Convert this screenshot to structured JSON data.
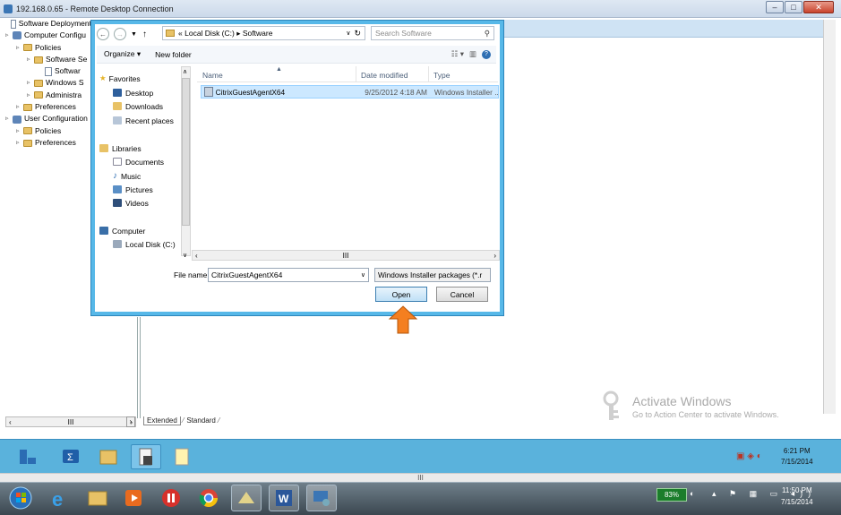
{
  "rdp": {
    "title": "192.168.0.65 - Remote Desktop Connection",
    "min": "–",
    "max": "□",
    "close": "✕"
  },
  "tree": [
    {
      "label": "Software Deployment",
      "indent": 0
    },
    {
      "label": "Computer Configu",
      "indent": 0
    },
    {
      "label": "Policies",
      "indent": 1
    },
    {
      "label": "Software Se",
      "indent": 2
    },
    {
      "label": "Softwar",
      "indent": 3
    },
    {
      "label": "Windows S",
      "indent": 2
    },
    {
      "label": "Administra",
      "indent": 2
    },
    {
      "label": "Preferences",
      "indent": 1
    },
    {
      "label": "User Configuration",
      "indent": 0
    },
    {
      "label": "Policies",
      "indent": 1
    },
    {
      "label": "Preferences",
      "indent": 1
    }
  ],
  "bottom_tabs": {
    "extended": "Extended",
    "standard": "Standard",
    "hscroll": "III"
  },
  "watermark": {
    "line1": "Activate Windows",
    "line2": "Go to Action Center to activate Windows."
  },
  "inner_clock": {
    "time": "6:21 PM",
    "date": "7/15/2014"
  },
  "outer_scroll": "III",
  "clock": {
    "time": "11:50 PM",
    "date": "7/15/2014"
  },
  "battery": "83%",
  "dialog": {
    "path": [
      "«",
      "Local Disk (C:)",
      "▸",
      "Software"
    ],
    "search_placeholder": "Search Software",
    "organize": "Organize ▾",
    "new_folder": "New folder",
    "nav": {
      "favorites": "Favorites",
      "desktop": "Desktop",
      "downloads": "Downloads",
      "recent": "Recent places",
      "libraries": "Libraries",
      "documents": "Documents",
      "music": "Music",
      "pictures": "Pictures",
      "videos": "Videos",
      "computer": "Computer",
      "local_disk": "Local Disk (C:)"
    },
    "columns": {
      "name": "Name",
      "date": "Date modified",
      "type": "Type"
    },
    "file": {
      "name": "CitrixGuestAgentX64",
      "date": "9/25/2012 4:18 AM",
      "type": "Windows Installer ..."
    },
    "hscroll": "III",
    "file_name_label": "File name:",
    "file_name_value": "CitrixGuestAgentX64",
    "file_type": "Windows Installer packages (*.r",
    "open": "Open",
    "cancel": "Cancel"
  },
  "colors": {
    "dialog_border": "#57b8e8",
    "selection": "#cce8ff",
    "arrow": "#f47f20",
    "inner_taskbar": "#5ab2dc"
  }
}
